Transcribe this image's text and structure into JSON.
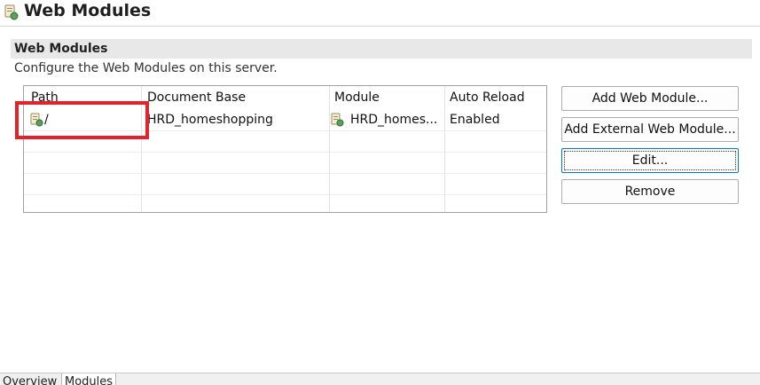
{
  "header": {
    "title": "Web Modules",
    "icon": "server-module-icon"
  },
  "section": {
    "title": "Web Modules",
    "description": "Configure the Web Modules on this server."
  },
  "table": {
    "columns": [
      "Path",
      "Document Base",
      "Module",
      "Auto Reload"
    ],
    "rows": [
      {
        "path": "/",
        "document_base": "HRD_homeshopping",
        "module": "HRD_homes...",
        "auto_reload": "Enabled"
      }
    ]
  },
  "buttons": {
    "add_web_module": "Add Web Module...",
    "add_external_web_module": "Add External Web Module...",
    "edit": "Edit...",
    "remove": "Remove"
  },
  "tabs": [
    "Overview",
    "Modules"
  ],
  "colors": {
    "highlight": "#e4222c",
    "focus": "#0078d7",
    "section_bar": "#e8e8e8"
  }
}
